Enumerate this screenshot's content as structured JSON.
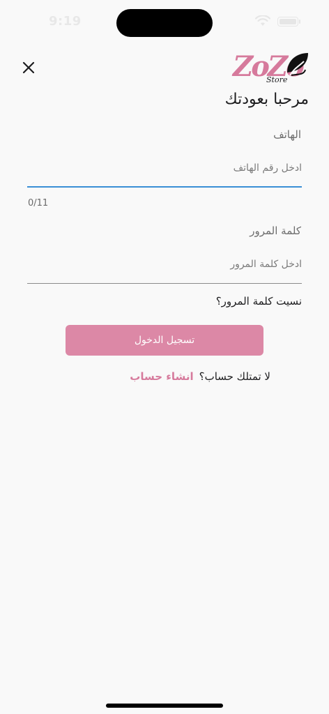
{
  "status_bar": {
    "time": "9:19"
  },
  "brand": {
    "logo_main": "ZoZo",
    "logo_sub": "Store",
    "accent": "#d67a9c"
  },
  "greeting": "مرحبا بعودتك",
  "phone": {
    "label": "الهاتف",
    "placeholder": "ادخل رقم الهاتف",
    "value": "",
    "counter": "0/11"
  },
  "password": {
    "label": "كلمة المرور",
    "placeholder": "ادخل كلمة المرور",
    "value": ""
  },
  "forgot_password": "نسيت كلمة المرور؟",
  "login_button": "تسجيل الدخول",
  "signup": {
    "prompt": "لا تمتلك حساب؟",
    "link": "انشاء حساب"
  },
  "colors": {
    "primary_button": "#dc88a6",
    "focus_underline": "#3a8fd6",
    "background": "#f9f9f9"
  }
}
